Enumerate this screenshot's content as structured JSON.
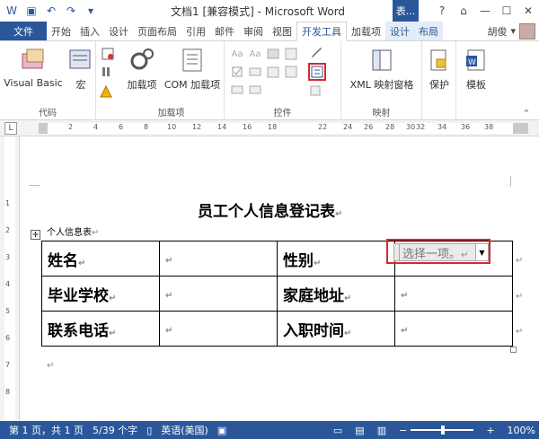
{
  "window": {
    "title": "文档1 [兼容模式] - Microsoft Word",
    "context_title": "表...",
    "buttons": [
      "?",
      "⌂",
      "—",
      "☐",
      "✕"
    ]
  },
  "tabs": {
    "file": "文件",
    "items": [
      "开始",
      "插入",
      "设计",
      "页面布局",
      "引用",
      "邮件",
      "审阅",
      "视图",
      "开发工具",
      "加载项",
      "设计",
      "布局"
    ],
    "active": "开发工具",
    "user": "胡俊"
  },
  "ribbon": {
    "code": {
      "label": "代码",
      "vb": "Visual Basic",
      "macro": "宏"
    },
    "addins": {
      "label": "加载项",
      "addin": "加载项",
      "com": "COM 加载项"
    },
    "controls": {
      "label": "控件"
    },
    "mapping": {
      "label": "映射",
      "xml": "XML 映射窗格"
    },
    "protect": {
      "label": "保护"
    },
    "template": {
      "label": "模板"
    }
  },
  "ruler": {
    "box": "L",
    "numbers": [
      "2",
      "4",
      "6",
      "8",
      "10",
      "12",
      "14",
      "16",
      "18",
      "22",
      "24",
      "26",
      "28",
      "30",
      "32",
      "34",
      "36",
      "38"
    ]
  },
  "vruler": {
    "numbers": [
      "1",
      "2",
      "3",
      "4",
      "5",
      "6",
      "7",
      "8"
    ]
  },
  "document": {
    "title": "员工个人信息登记表",
    "caption": "个人信息表",
    "rows": [
      [
        "姓名",
        "",
        "性别",
        ""
      ],
      [
        "毕业学校",
        "",
        "家庭地址",
        ""
      ],
      [
        "联系电话",
        "",
        "入职时间",
        ""
      ]
    ],
    "dropdown_placeholder": "选择一项。"
  },
  "status": {
    "page": "第 1 页，共 1 页",
    "words": "5/39 个字",
    "lang": "英语(美国)",
    "zoom": "100%"
  },
  "colors": {
    "accent": "#2b579a",
    "highlight": "#d9262d"
  }
}
